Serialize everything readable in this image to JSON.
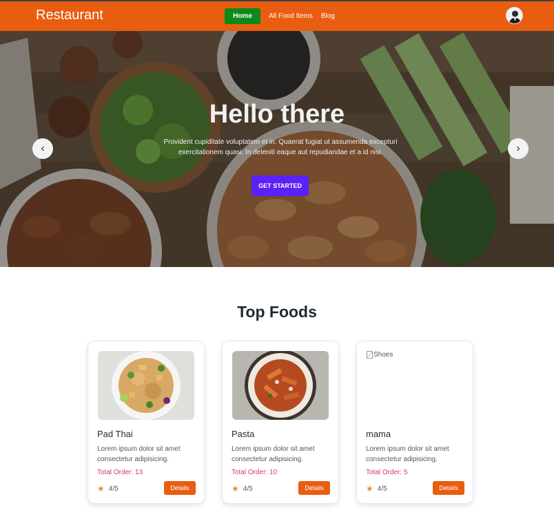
{
  "navbar": {
    "brand": "Restaurant",
    "links": [
      "Home",
      "All Food Items",
      "Blog"
    ],
    "active_color": "#0a8a1a",
    "bar_color": "#e85d10"
  },
  "hero": {
    "title": "Hello there",
    "text": "Provident cupiditate voluptatem et in. Quaerat fugiat ut assumenda excepturi exercitationem quasi. In deleniti eaque aut repudiandae et a id nisi.",
    "button": "GET STARTED",
    "prev_icon": "‹",
    "next_icon": "›",
    "button_color": "#5b21f5"
  },
  "section": {
    "title": "Top Foods"
  },
  "cards": [
    {
      "name": "Pad Thai",
      "desc": "Lorem ipsum dolor sit amet consectetur adipisicing.",
      "orders": "Total Order: 13",
      "rating": "4/5",
      "button": "Details"
    },
    {
      "name": "Pasta",
      "desc": "Lorem ipsum dolor sit amet consectetur adipisicing.",
      "orders": "Total Order: 10",
      "rating": "4/5",
      "button": "Details"
    },
    {
      "name": "mama",
      "desc": "Lorem ipsum dolor sit amet consectetur adipisicing.",
      "orders": "Total Order: 5",
      "rating": "4/5",
      "button": "Details",
      "image_alt": "Shoes"
    }
  ]
}
